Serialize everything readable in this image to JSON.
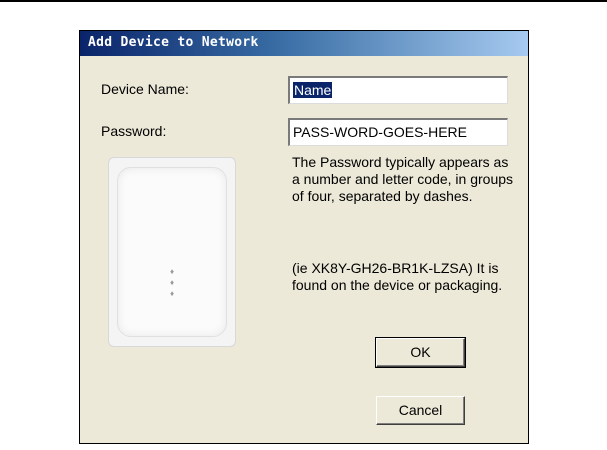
{
  "dialog": {
    "title": "Add Device to Network",
    "device_name_label": "Device Name:",
    "device_name_value": "Name",
    "password_label": "Password:",
    "password_value": "PASS-WORD-GOES-HERE",
    "info_paragraph_1": "The Password typically appears as a number and letter code, in groups of four, separated by dashes.",
    "info_paragraph_2": "(ie XK8Y-GH26-BR1K-LZSA) It is found on the device or packaging.",
    "ok_label": "OK",
    "cancel_label": "Cancel",
    "led_symbol": "♦",
    "colors": {
      "dialog_bg": "#ece9d8",
      "title_gradient_start": "#0a246a",
      "title_gradient_end": "#a6caf0",
      "selection_bg": "#0a246a"
    },
    "device_image_icon": "powerline-adapter-icon"
  }
}
